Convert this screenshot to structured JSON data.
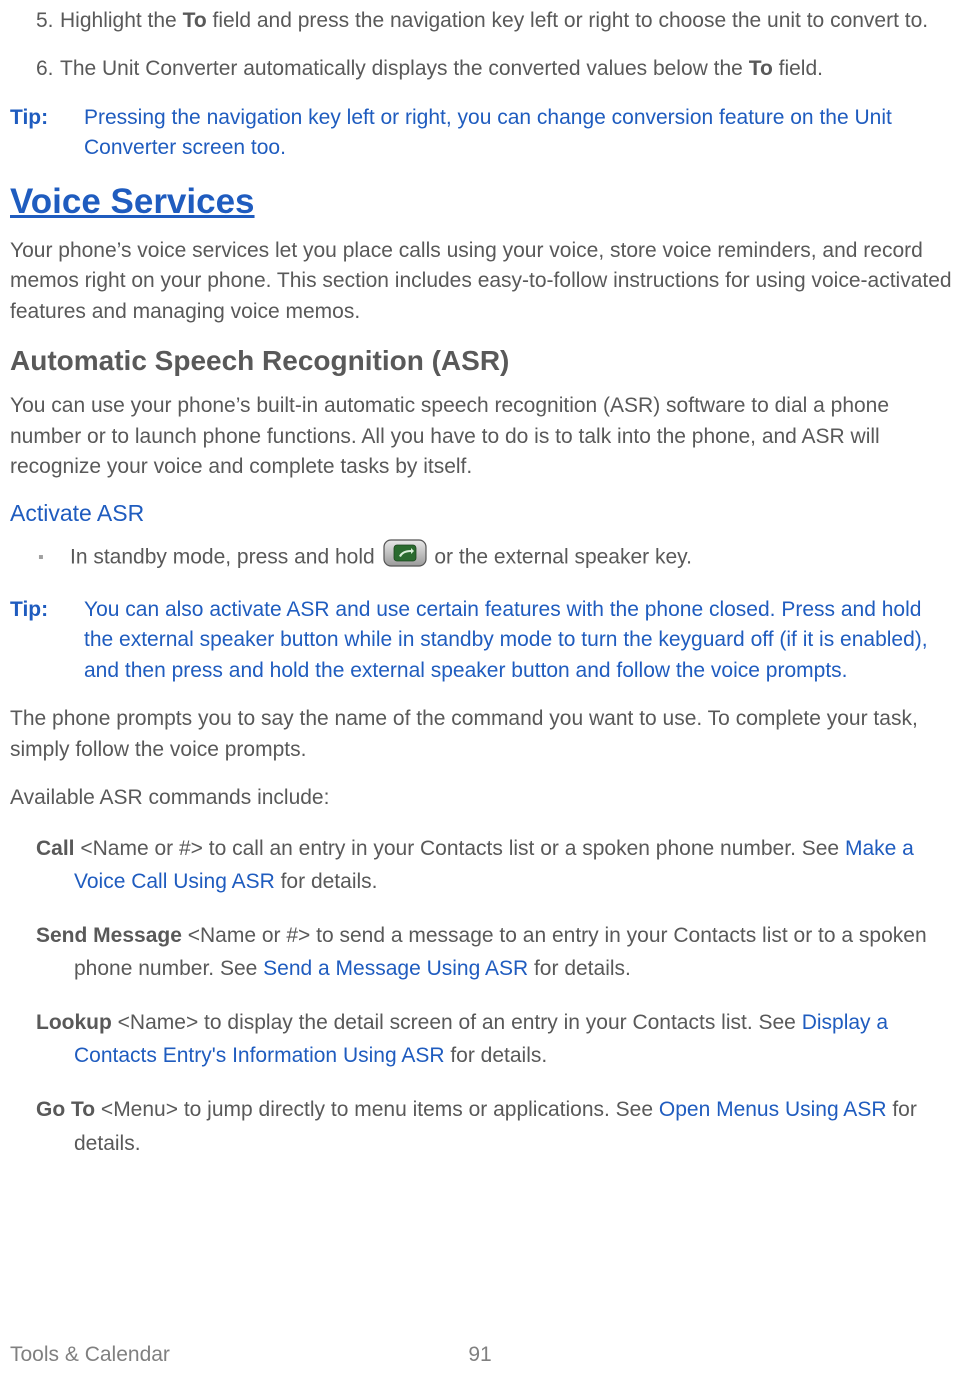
{
  "list": {
    "item5": {
      "num": "5.",
      "pre": "Highlight the ",
      "bold": "To",
      "post": " field and press the navigation key left or right to choose the unit to convert to."
    },
    "item6": {
      "num": "6.",
      "pre": "The Unit Converter automatically displays the converted values below the ",
      "bold": "To",
      "post": " field."
    }
  },
  "tip1": {
    "label": "Tip:",
    "text": "Pressing the navigation key left or right, you can change conversion feature on the Unit Converter screen too."
  },
  "h1": "Voice Services",
  "intro": "Your phone’s voice services let you place calls using your voice, store voice reminders, and record memos right on your phone. This section includes easy-to-follow instructions for using voice-activated features and managing voice memos.",
  "h2": "Automatic Speech Recognition (ASR)",
  "asr_intro": "You can use your phone’s built-in automatic speech recognition (ASR) software to dial a phone number or to launch phone functions. All you have to do is to talk into the phone, and ASR will recognize your voice and complete tasks by itself.",
  "h3": "Activate ASR",
  "bullet": {
    "pre": "In standby mode, press and hold ",
    "post": " or the external speaker key."
  },
  "tip2": {
    "label": "Tip:",
    "text": "You can also activate ASR and use certain features with the phone closed. Press and hold the external speaker button while in standby mode to turn the keyguard off (if it is enabled), and then press and hold the external speaker button and follow the voice prompts."
  },
  "after_tip": "The phone prompts you to say the name of the command you want to use. To complete your task, simply follow the voice prompts.",
  "avail": "Available ASR commands include:",
  "cmds": {
    "call": {
      "bold": "Call",
      "text1": " <Name or #> to call an entry in your Contacts list or a spoken phone number. See ",
      "link": "Make a Voice Call Using ASR",
      "text2": " for details."
    },
    "send": {
      "bold": "Send Message",
      "text1": " <Name or #> to send a message to an entry in your Contacts list or to a spoken phone number. See ",
      "link": "Send a Message Using ASR",
      "text2": " for details."
    },
    "lookup": {
      "bold": "Lookup",
      "text1": " <Name> to display the detail screen of an entry in your Contacts list. See ",
      "link": "Display a Contacts Entry's Information Using ASR",
      "text2": " for details."
    },
    "goto": {
      "bold": "Go To",
      "text1": " <Menu> to jump directly to menu items or applications. See ",
      "link": "Open Menus Using ASR",
      "text2": " for details."
    }
  },
  "footer": {
    "section": "Tools & Calendar",
    "page": "91"
  }
}
